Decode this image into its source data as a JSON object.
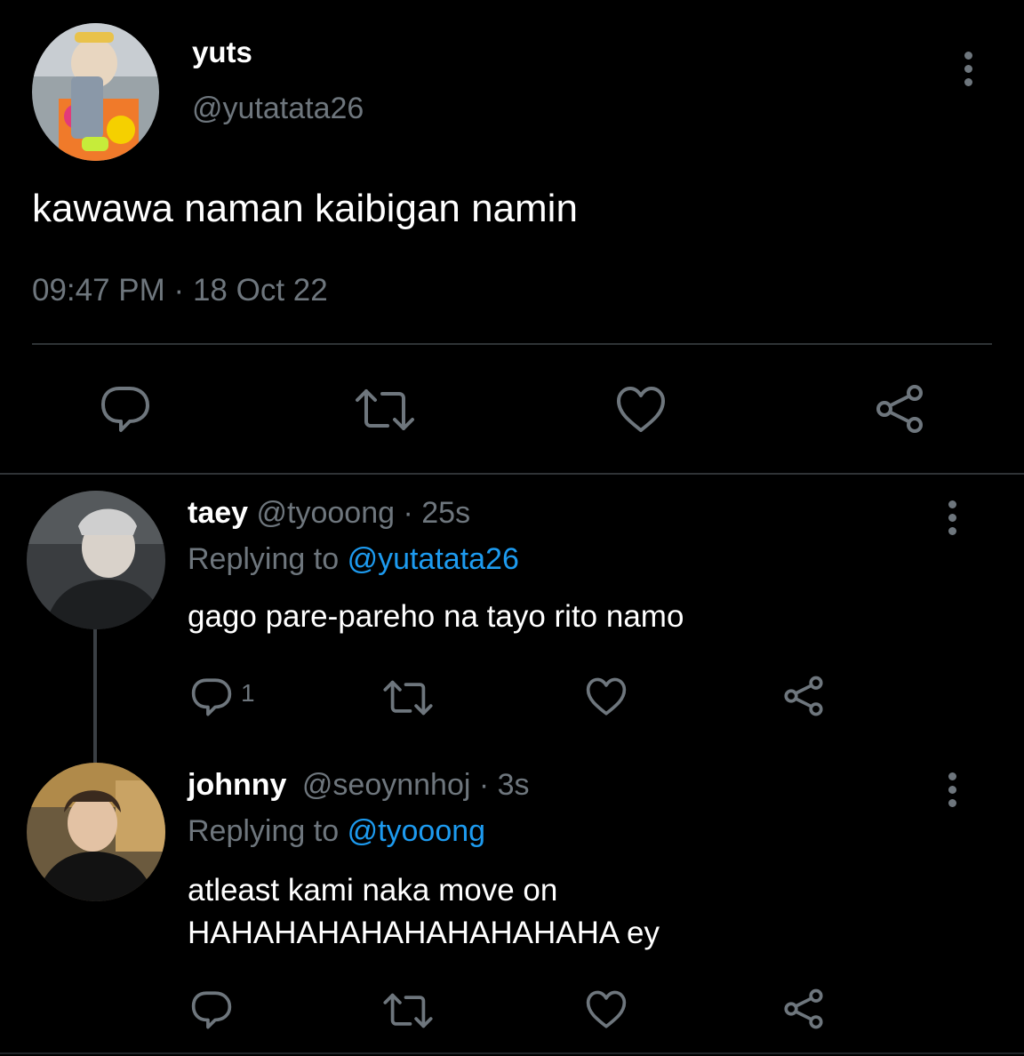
{
  "main_tweet": {
    "display_name": "yuts",
    "handle": "@yutatata26",
    "text": "kawawa naman kaibigan namin",
    "time": "09:47 PM",
    "separator": "·",
    "date": "18 Oct 22"
  },
  "replies": [
    {
      "display_name": "taey",
      "handle": "@tyooong",
      "age": "· 25s",
      "replying_label": "Replying to",
      "replying_to": "@yutatata26",
      "text_lines": [
        "gago pare-pareho na tayo rito namo"
      ],
      "reply_count": "1"
    },
    {
      "display_name": "johnny",
      "handle": "@seoynnhoj",
      "age": "· 3s",
      "replying_label": "Replying to",
      "replying_to": "@tyooong",
      "text_lines": [
        "atleast kami naka move on",
        "HAHAHAHAHAHAHAHAHAHA ey"
      ],
      "reply_count": ""
    }
  ],
  "icons": {
    "reply": "reply-icon",
    "retweet": "retweet-icon",
    "like": "heart-icon",
    "share": "share-icon",
    "more": "more-vertical-icon"
  },
  "colors": {
    "background": "#000000",
    "text": "#ffffff",
    "muted": "#6e767d",
    "link": "#1d9bf0",
    "divider": "#2f3336"
  }
}
